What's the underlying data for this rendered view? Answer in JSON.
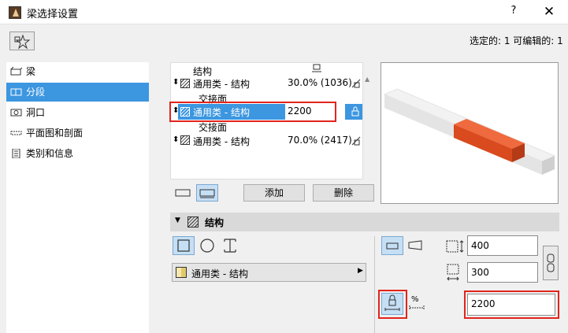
{
  "window": {
    "title": "梁选择设置",
    "help": "?",
    "close": "✕"
  },
  "status": "选定的: 1 可编辑的: 1",
  "sidebar": {
    "items": [
      {
        "label": "梁"
      },
      {
        "label": "分段"
      },
      {
        "label": "洞口"
      },
      {
        "label": "平面图和剖面"
      },
      {
        "label": "类别和信息"
      }
    ]
  },
  "tree": {
    "header_col": "结构",
    "rows": [
      {
        "label": "通用类 - 结构",
        "value": "30.0% (1036)"
      },
      {
        "label": "交接面"
      },
      {
        "label": "通用类 - 结构",
        "value": "2200"
      },
      {
        "label": "交接面"
      },
      {
        "label": "通用类 - 结构",
        "value": "70.0% (2417)"
      }
    ]
  },
  "buttons": {
    "add": "添加",
    "delete": "删除"
  },
  "section": {
    "title": "结构"
  },
  "profile": {
    "material": "通用类 - 结构"
  },
  "dimensions": {
    "width": "400",
    "height": "300",
    "length": "2200",
    "percent_symbol": "%"
  },
  "colors": {
    "selection": "#3c96e0",
    "highlight": "#e2241c",
    "beam_segment": "#d94a1e"
  }
}
